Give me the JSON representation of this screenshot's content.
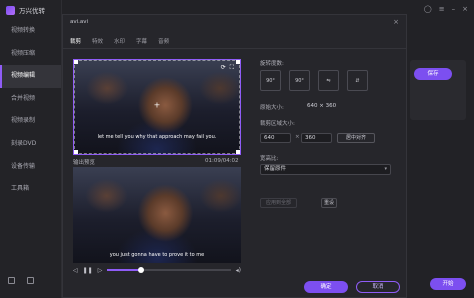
{
  "app": {
    "title": "万兴优转"
  },
  "sidebar": {
    "items": [
      {
        "label": "视频转换"
      },
      {
        "label": "视频压缩"
      },
      {
        "label": "视频编辑"
      },
      {
        "label": "合并视频"
      },
      {
        "label": "视频录制"
      },
      {
        "label": "刻录DVD"
      },
      {
        "label": "设备传输"
      },
      {
        "label": "工具箱"
      }
    ],
    "active_index": 2
  },
  "background": {
    "save_label": "保存",
    "start_label": "开始"
  },
  "dialog": {
    "file_name": "avi.avi",
    "tabs": [
      "裁剪",
      "特效",
      "水印",
      "字幕",
      "音频"
    ],
    "active_tab": 0,
    "preview": {
      "subtitle_top": "let me tell you why that approach may fail you.",
      "subtitle_bottom": "you just gonna have to prove it to me",
      "output_label": "输出预览",
      "time": "01:09/04:02",
      "progress": 0.27
    },
    "settings": {
      "rotation_label": "旋转度数:",
      "rotation_buttons": [
        "90°",
        "90°",
        "⇋",
        "⇵"
      ],
      "original_size_label": "原始大小:",
      "original_size_value": "640 × 360",
      "crop_size_label": "裁剪区域大小:",
      "crop_width": "640",
      "crop_height": "360",
      "times_sign": "×",
      "center_label": "居中对齐",
      "aspect_label": "宽高比:",
      "aspect_value": "保留原件",
      "apply_all_label": "应用到全部",
      "reset_label": "重设"
    },
    "ok_label": "确定",
    "cancel_label": "取消"
  }
}
